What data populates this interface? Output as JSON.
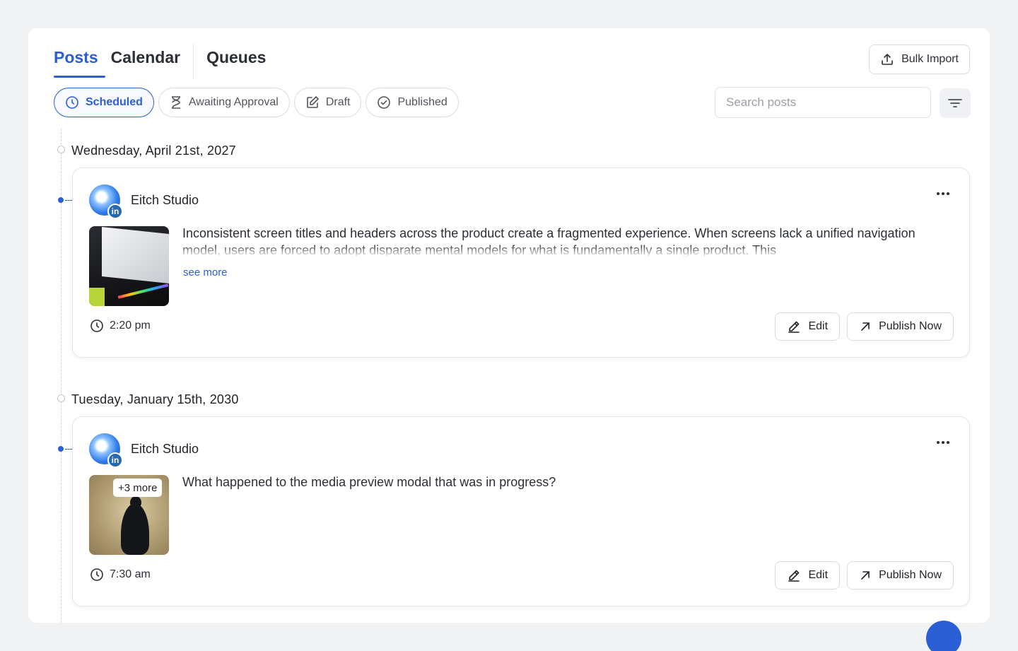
{
  "tabs": {
    "posts": "Posts",
    "calendar": "Calendar",
    "queues": "Queues"
  },
  "bulk_import": {
    "label": "Bulk Import",
    "icon": "upload-icon"
  },
  "filters": {
    "scheduled": "Scheduled",
    "awaiting": "Awaiting Approval",
    "draft": "Draft",
    "published": "Published"
  },
  "search": {
    "placeholder": "Search posts",
    "value": ""
  },
  "colors": {
    "accent": "#2a5fd6",
    "linkedin": "#2867b2"
  },
  "groups": [
    {
      "date": "Wednesday, April 21st, 2027",
      "post": {
        "account": "Eitch Studio",
        "network": "in",
        "text": "Inconsistent screen titles and headers across the product create a fragmented experience. When screens lack a unified navigation model, users are forced to adopt disparate mental models for what is fundamentally a single product. This",
        "see_more": "see more",
        "time": "2:20 pm",
        "edit": "Edit",
        "publish": "Publish Now"
      }
    },
    {
      "date": "Tuesday, January 15th, 2030",
      "post": {
        "account": "Eitch Studio",
        "network": "in",
        "media_more": "+3 more",
        "text": "What happened to the media preview modal that was in progress?",
        "time": "7:30 am",
        "edit": "Edit",
        "publish": "Publish Now"
      }
    }
  ]
}
